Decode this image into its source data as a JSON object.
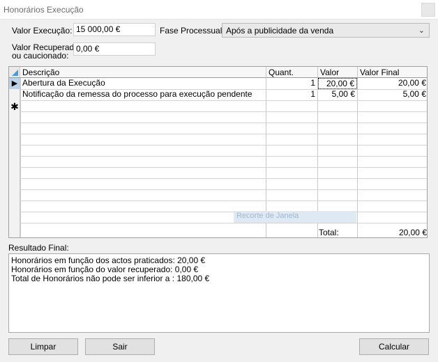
{
  "window": {
    "title": "Honorários Execução"
  },
  "form": {
    "valor_execucao_label": "Valor Execução:",
    "valor_execucao": "15 000,00 €",
    "fase_label": "Fase Processual:",
    "fase_value": "Após a publicidade da venda",
    "valor_recuperado_label_1": "Valor Recuperado",
    "valor_recuperado_label_2": "ou caucionado:",
    "valor_recuperado": "0,00 €"
  },
  "grid": {
    "columns": [
      "Descrição",
      "Quant.",
      "Valor",
      "Valor Final"
    ],
    "rows": [
      {
        "desc": "Abertura da Execução",
        "qty": "1",
        "valor": "20,00 €",
        "final": "20,00 €"
      },
      {
        "desc": "Notificação da remessa do processo para execução pendente",
        "qty": "1",
        "valor": "5,00 €",
        "final": "5,00 €"
      }
    ],
    "total_label": "Total:",
    "total_value": "20,00 €",
    "watermark": "Recorte de Janela"
  },
  "result": {
    "label": "Resultado Final:",
    "lines": [
      "Honorários em função dos actos praticados: 20,00 €",
      "Honorários em função do valor recuperado: 0,00 €",
      "Total de Honorários não pode ser inferior a : 180,00 €"
    ]
  },
  "buttons": {
    "limpar": "Limpar",
    "sair": "Sair",
    "calcular": "Calcular"
  },
  "icons": {
    "current_row": "row-pointer-triangle",
    "new_row": "asterisk",
    "dropdown": "chevron-down"
  }
}
